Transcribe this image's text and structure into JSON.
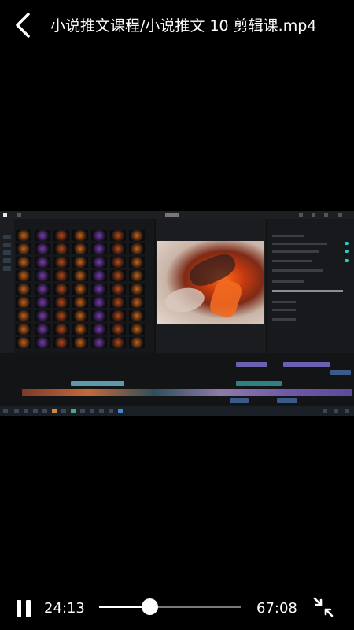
{
  "header": {
    "title": "小说推文课程/小说推文 10 剪辑课.mp4",
    "back_icon": "back-arrow-icon"
  },
  "video": {
    "content": "screen-recording of video editor"
  },
  "controls": {
    "current_time": "24:13",
    "duration": "67:08",
    "progress": 0.361,
    "pause_icon": "pause-icon",
    "fullscreen_icon": "exit-fullscreen-icon"
  }
}
